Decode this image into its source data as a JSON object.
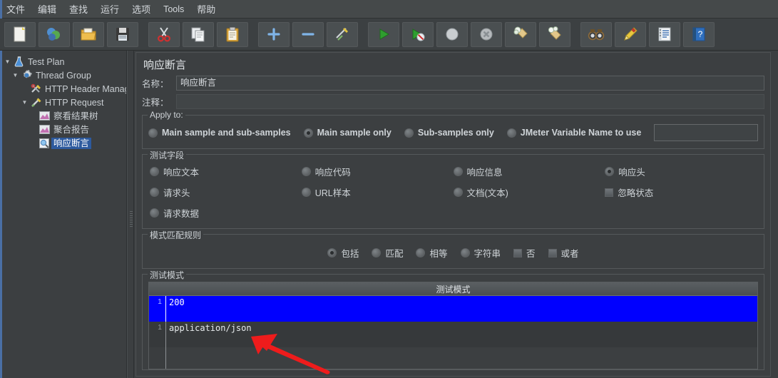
{
  "window": {
    "menu": [
      {
        "label": "文件",
        "name": "menu-file"
      },
      {
        "label": "编辑",
        "name": "menu-edit"
      },
      {
        "label": "查找",
        "name": "menu-search"
      },
      {
        "label": "运行",
        "name": "menu-run"
      },
      {
        "label": "选项",
        "name": "menu-options"
      },
      {
        "label": "Tools",
        "name": "menu-tools"
      },
      {
        "label": "帮助",
        "name": "menu-help"
      }
    ]
  },
  "toolbar": {
    "buttons": [
      {
        "icon": "new-file-icon",
        "name": "toolbar-new"
      },
      {
        "icon": "templates-icon",
        "name": "toolbar-templates"
      },
      {
        "icon": "open-folder-icon",
        "name": "toolbar-open"
      },
      {
        "icon": "save-floppy-icon",
        "name": "toolbar-save"
      },
      {
        "icon": "scissors-cut-icon",
        "name": "toolbar-cut"
      },
      {
        "icon": "copy-pages-icon",
        "name": "toolbar-copy"
      },
      {
        "icon": "clipboard-paste-icon",
        "name": "toolbar-paste"
      },
      {
        "icon": "plus-icon",
        "name": "toolbar-expand"
      },
      {
        "icon": "minus-icon",
        "name": "toolbar-collapse"
      },
      {
        "icon": "toggle-pencil-icon",
        "name": "toolbar-toggle"
      },
      {
        "icon": "play-start-icon",
        "name": "toolbar-start"
      },
      {
        "icon": "play-no-timers-icon",
        "name": "toolbar-start-no-pauses"
      },
      {
        "icon": "stop-circle-icon",
        "name": "toolbar-stop"
      },
      {
        "icon": "shutdown-icon",
        "name": "toolbar-shutdown"
      },
      {
        "icon": "broom-clear-icon",
        "name": "toolbar-clear"
      },
      {
        "icon": "broom-clear-all-icon",
        "name": "toolbar-clear-all"
      },
      {
        "icon": "binoculars-search-icon",
        "name": "toolbar-search"
      },
      {
        "icon": "eraser-reset-search-icon",
        "name": "toolbar-reset-search"
      },
      {
        "icon": "function-helper-icon",
        "name": "toolbar-function-helper"
      },
      {
        "icon": "help-question-icon",
        "name": "toolbar-help"
      }
    ]
  },
  "tree": {
    "nodes": [
      {
        "label": "Test Plan",
        "icon": "flask-icon",
        "indent": 0,
        "twist": "▼",
        "selected": false
      },
      {
        "label": "Thread Group",
        "icon": "gear-icon",
        "indent": 1,
        "twist": "▼",
        "selected": false
      },
      {
        "label": "HTTP Header Manag",
        "icon": "header-manager-icon",
        "indent": 2,
        "twist": "",
        "selected": false
      },
      {
        "label": "HTTP Request",
        "icon": "http-request-icon",
        "indent": 2,
        "twist": "▼",
        "selected": false
      },
      {
        "label": "察看结果树",
        "icon": "results-tree-icon",
        "indent": 3,
        "twist": "",
        "selected": false
      },
      {
        "label": "聚合报告",
        "icon": "aggregate-report-icon",
        "indent": 3,
        "twist": "",
        "selected": false
      },
      {
        "label": "响应断言",
        "icon": "assertion-icon",
        "indent": 3,
        "twist": "",
        "selected": true
      }
    ]
  },
  "panel": {
    "title": "响应断言",
    "name_label": "名称：",
    "name_value": "响应断言",
    "comment_label": "注释：",
    "comment_value": "",
    "apply_to": {
      "title": "Apply to:",
      "options": [
        {
          "label": "Main sample and sub-samples",
          "selected": false
        },
        {
          "label": "Main sample only",
          "selected": true
        },
        {
          "label": "Sub-samples only",
          "selected": false
        },
        {
          "label": "JMeter Variable Name to use",
          "selected": false
        }
      ],
      "variable_value": ""
    },
    "test_field": {
      "title": "测试字段",
      "options": [
        {
          "label": "响应文本",
          "selected": false,
          "type": "radio"
        },
        {
          "label": "响应代码",
          "selected": false,
          "type": "radio"
        },
        {
          "label": "响应信息",
          "selected": false,
          "type": "radio"
        },
        {
          "label": "响应头",
          "selected": true,
          "type": "radio"
        },
        {
          "label": "请求头",
          "selected": false,
          "type": "radio"
        },
        {
          "label": "URL样本",
          "selected": false,
          "type": "radio"
        },
        {
          "label": "文档(文本)",
          "selected": false,
          "type": "radio"
        },
        {
          "label": "忽略状态",
          "selected": false,
          "type": "checkbox"
        },
        {
          "label": "请求数据",
          "selected": false,
          "type": "radio"
        },
        {
          "label": "",
          "selected": false,
          "type": "none"
        },
        {
          "label": "",
          "selected": false,
          "type": "none"
        },
        {
          "label": "",
          "selected": false,
          "type": "none"
        }
      ]
    },
    "match_rules": {
      "title": "模式匹配规则",
      "options": [
        {
          "label": "包括",
          "selected": true,
          "type": "radio"
        },
        {
          "label": "匹配",
          "selected": false,
          "type": "radio"
        },
        {
          "label": "相等",
          "selected": false,
          "type": "radio"
        },
        {
          "label": "字符串",
          "selected": false,
          "type": "radio"
        },
        {
          "label": "否",
          "selected": false,
          "type": "checkbox"
        },
        {
          "label": "或者",
          "selected": false,
          "type": "checkbox"
        }
      ]
    },
    "patterns": {
      "title": "测试模式",
      "column_header": "测试模式",
      "rows": [
        {
          "index": "1",
          "value": "200",
          "selected": true
        },
        {
          "index": "1",
          "value": "application/json",
          "selected": false
        }
      ]
    }
  },
  "annotation": {
    "arrow_color": "#ee1c1c",
    "points_to": "application/json"
  }
}
